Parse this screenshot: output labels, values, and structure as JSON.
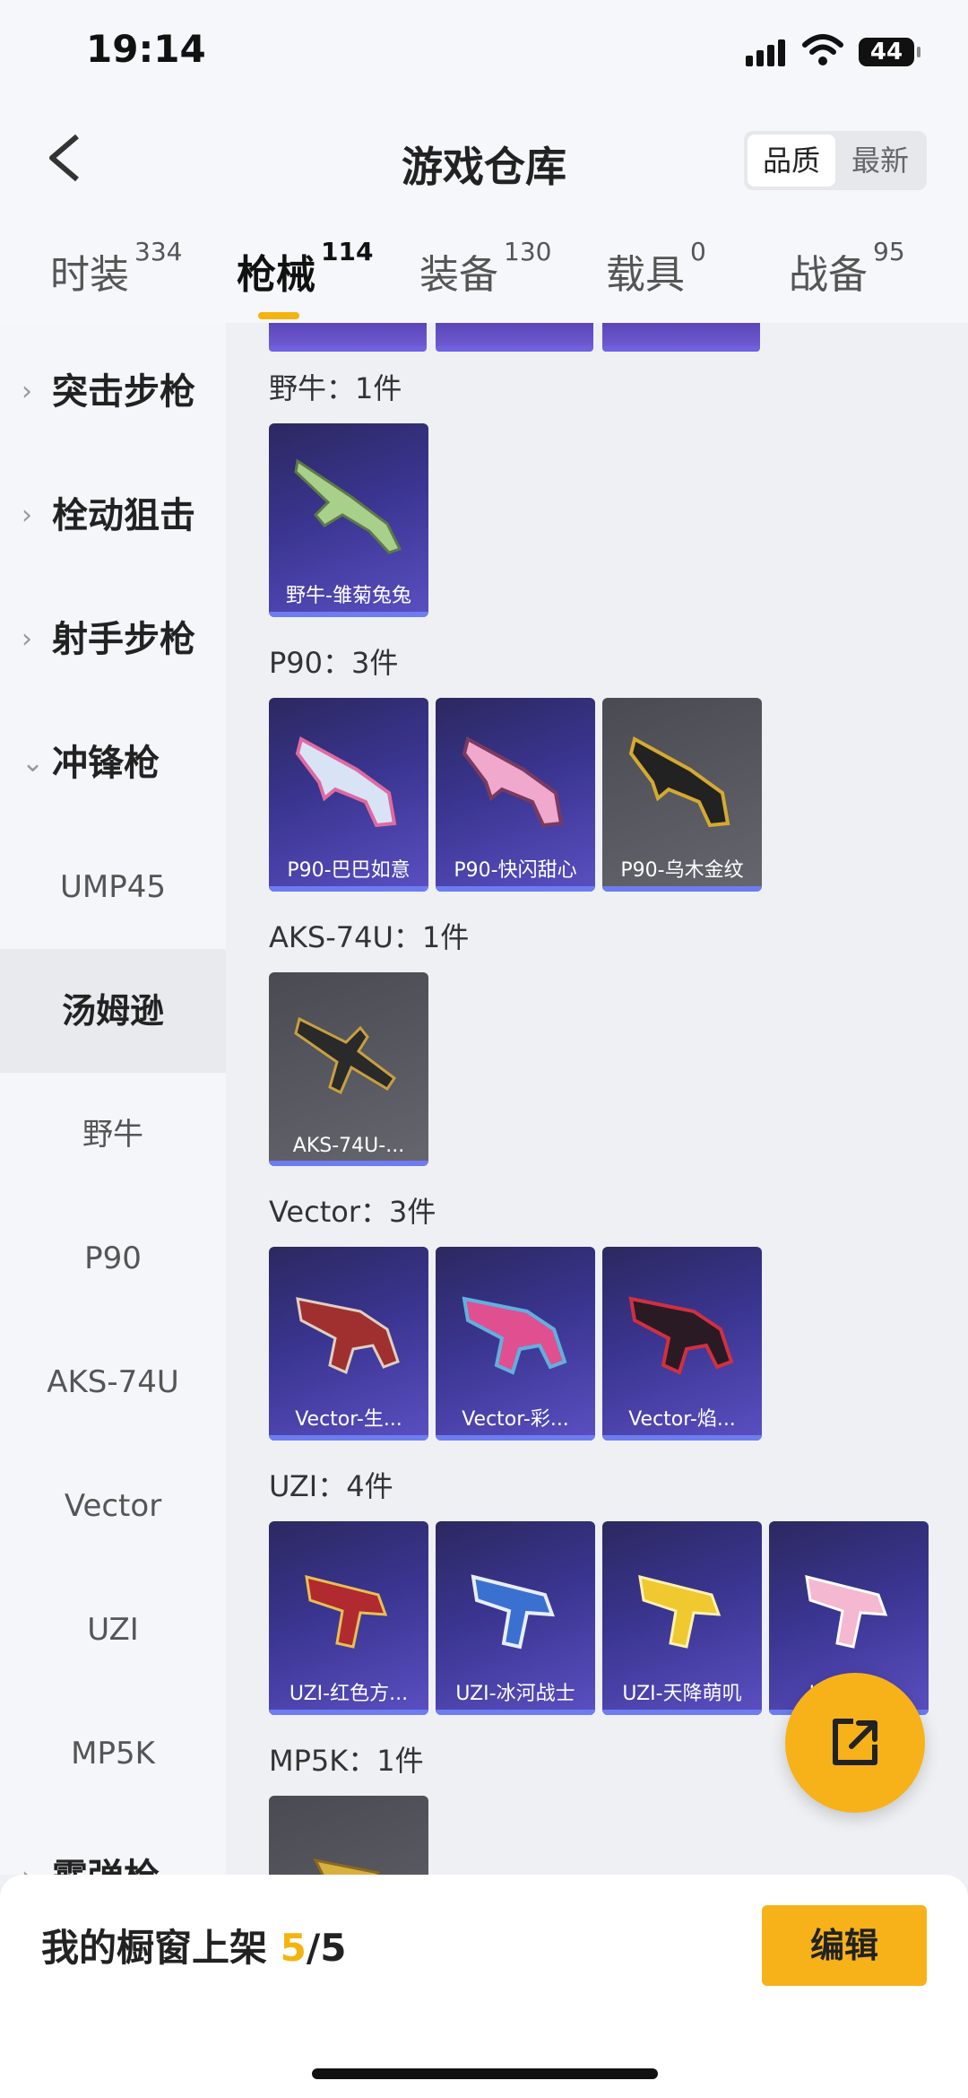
{
  "status_bar": {
    "time": "19:14",
    "battery": "44"
  },
  "header": {
    "title": "游戏仓库",
    "sort": {
      "selected": "品质",
      "other": "最新"
    }
  },
  "tabs": [
    {
      "label": "时装",
      "count": "334"
    },
    {
      "label": "枪械",
      "count": "114"
    },
    {
      "label": "装备",
      "count": "130"
    },
    {
      "label": "载具",
      "count": "0"
    },
    {
      "label": "战备",
      "count": "95"
    }
  ],
  "sidebar": {
    "categories": [
      "突击步枪",
      "栓动狙击",
      "射手步枪",
      "冲锋枪"
    ],
    "subitems": [
      "UMP45",
      "汤姆逊",
      "野牛",
      "P90",
      "AKS-74U",
      "Vector",
      "UZI",
      "MP5K"
    ],
    "partial_category": "霰弹枪"
  },
  "groups": [
    {
      "title": "野牛：1件",
      "items": [
        "野牛-雏菊兔兔"
      ]
    },
    {
      "title": "P90：3件",
      "items": [
        "P90-巴巴如意",
        "P90-快闪甜心",
        "P90-乌木金纹"
      ]
    },
    {
      "title": "AKS-74U：1件",
      "items": [
        "AKS-74U-..."
      ]
    },
    {
      "title": "Vector：3件",
      "items": [
        "Vector-生...",
        "Vector-彩...",
        "Vector-焰..."
      ]
    },
    {
      "title": "UZI：4件",
      "items": [
        "UZI-红色方...",
        "UZI-冰河战士",
        "UZI-天降萌叽",
        "UZI-...猪"
      ]
    },
    {
      "title": "MP5K：1件",
      "items": [
        ""
      ]
    }
  ],
  "bottom_bar": {
    "label": "我的橱窗上架 ",
    "current": "5",
    "total": "/5",
    "edit": "编辑"
  },
  "colors": {
    "accent": "#f7b21a",
    "card_purple": "#3a3590",
    "card_gray": "#55555d"
  }
}
